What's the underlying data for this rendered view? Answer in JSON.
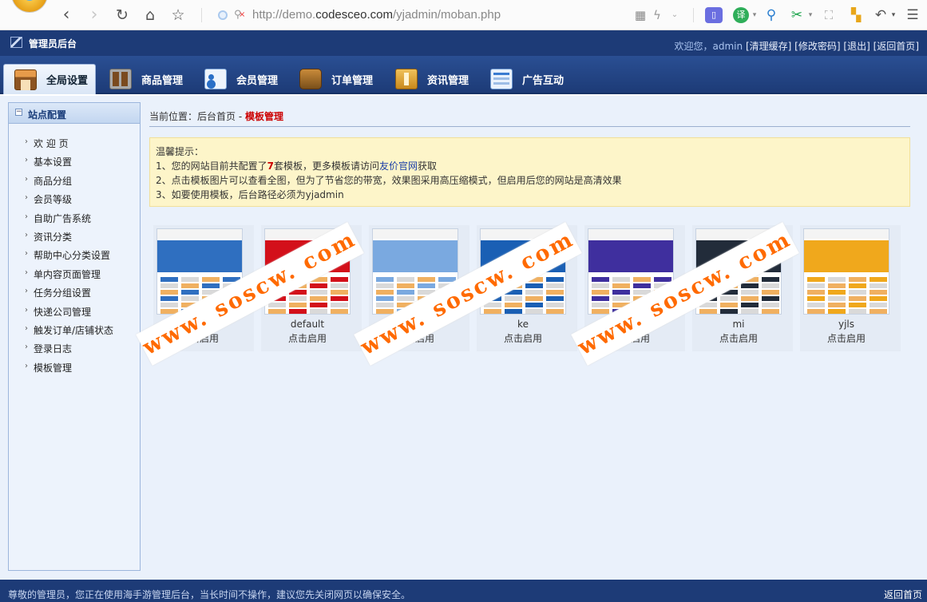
{
  "browser": {
    "url_protocol": "http://",
    "url_host_pre": "demo.",
    "url_host": "codesceo.com",
    "url_path": "/yjadmin/moban.php",
    "translate_label": "译"
  },
  "header": {
    "title": "管理员后台",
    "welcome": "欢迎您，admin",
    "links": [
      "清理缓存",
      "修改密码",
      "退出",
      "返回首页"
    ]
  },
  "tabs": [
    {
      "label": "全局设置",
      "icon": "home-icon"
    },
    {
      "label": "商品管理",
      "icon": "goods-icon"
    },
    {
      "label": "会员管理",
      "icon": "member-icon"
    },
    {
      "label": "订单管理",
      "icon": "wallet-icon"
    },
    {
      "label": "资讯管理",
      "icon": "news-icon"
    },
    {
      "label": "广告互动",
      "icon": "ad-icon"
    }
  ],
  "sidebar": {
    "title": "站点配置",
    "items": [
      "欢 迎 页",
      "基本设置",
      "商品分组",
      "会员等级",
      "自助广告系统",
      "资讯分类",
      "帮助中心分类设置",
      "单内容页面管理",
      "任务分组设置",
      "快递公司管理",
      "触发订单/店铺状态",
      "登录日志",
      "模板管理"
    ]
  },
  "breadcrumb": {
    "prefix": "当前位置：后台首页 - ",
    "current": "模板管理"
  },
  "tips": {
    "heading": "温馨提示：",
    "line1_a": "1、您的网站目前共配置了",
    "line1_num": "7",
    "line1_b": "套模板，更多模板请访问",
    "line1_link": "友价官网",
    "line1_c": "获取",
    "line2": "2、点击模板图片可以查看全图，但为了节省您的带宽，效果图采用高压缩模式，但启用后您的网站是高清效果",
    "line3": "3、如要使用模板，后台路径必须为yjadmin"
  },
  "templates": [
    {
      "name": "",
      "action": "点击启用",
      "accent": "#2f6fc0"
    },
    {
      "name": "default",
      "action": "点击启用",
      "accent": "#d3101a"
    },
    {
      "name": "",
      "action": "点击启用",
      "accent": "#7aa9e0"
    },
    {
      "name": "ke",
      "action": "点击启用",
      "accent": "#1a5fb4"
    },
    {
      "name": "",
      "action": "点击启用",
      "accent": "#3f2f9e"
    },
    {
      "name": "mi",
      "action": "点击启用",
      "accent": "#222c3a"
    },
    {
      "name": "yjls",
      "action": "点击启用",
      "accent": "#f0a81c"
    }
  ],
  "watermark": "www. soscw. com",
  "footer": {
    "notice": "尊敬的管理员，您正在使用海手游管理后台，当长时间不操作，建议您先关闭网页以确保安全。",
    "back": "返回首页"
  }
}
